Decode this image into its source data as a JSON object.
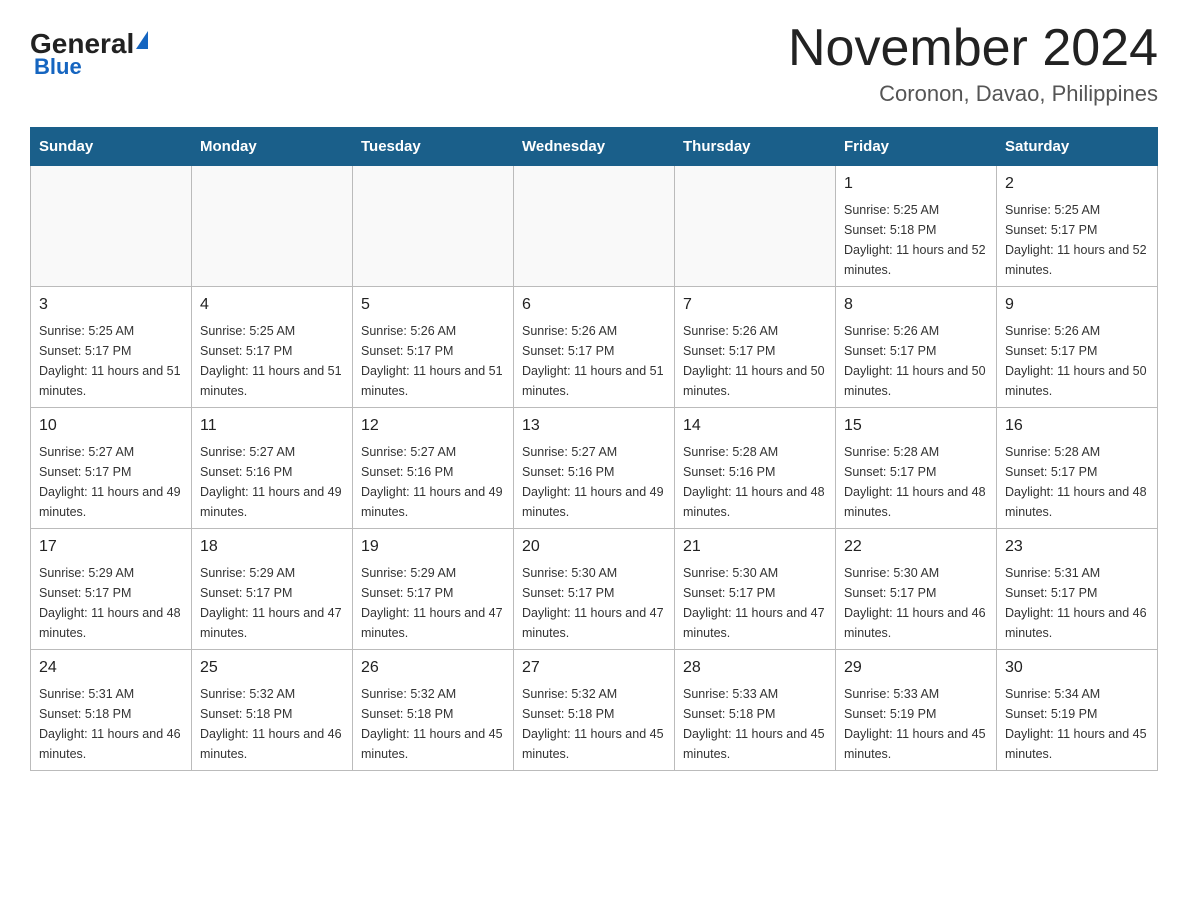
{
  "header": {
    "logo_general": "General",
    "logo_blue": "Blue",
    "month_title": "November 2024",
    "location": "Coronon, Davao, Philippines"
  },
  "weekdays": [
    "Sunday",
    "Monday",
    "Tuesday",
    "Wednesday",
    "Thursday",
    "Friday",
    "Saturday"
  ],
  "weeks": [
    [
      {
        "day": "",
        "sunrise": "",
        "sunset": "",
        "daylight": ""
      },
      {
        "day": "",
        "sunrise": "",
        "sunset": "",
        "daylight": ""
      },
      {
        "day": "",
        "sunrise": "",
        "sunset": "",
        "daylight": ""
      },
      {
        "day": "",
        "sunrise": "",
        "sunset": "",
        "daylight": ""
      },
      {
        "day": "",
        "sunrise": "",
        "sunset": "",
        "daylight": ""
      },
      {
        "day": "1",
        "sunrise": "Sunrise: 5:25 AM",
        "sunset": "Sunset: 5:18 PM",
        "daylight": "Daylight: 11 hours and 52 minutes."
      },
      {
        "day": "2",
        "sunrise": "Sunrise: 5:25 AM",
        "sunset": "Sunset: 5:17 PM",
        "daylight": "Daylight: 11 hours and 52 minutes."
      }
    ],
    [
      {
        "day": "3",
        "sunrise": "Sunrise: 5:25 AM",
        "sunset": "Sunset: 5:17 PM",
        "daylight": "Daylight: 11 hours and 51 minutes."
      },
      {
        "day": "4",
        "sunrise": "Sunrise: 5:25 AM",
        "sunset": "Sunset: 5:17 PM",
        "daylight": "Daylight: 11 hours and 51 minutes."
      },
      {
        "day": "5",
        "sunrise": "Sunrise: 5:26 AM",
        "sunset": "Sunset: 5:17 PM",
        "daylight": "Daylight: 11 hours and 51 minutes."
      },
      {
        "day": "6",
        "sunrise": "Sunrise: 5:26 AM",
        "sunset": "Sunset: 5:17 PM",
        "daylight": "Daylight: 11 hours and 51 minutes."
      },
      {
        "day": "7",
        "sunrise": "Sunrise: 5:26 AM",
        "sunset": "Sunset: 5:17 PM",
        "daylight": "Daylight: 11 hours and 50 minutes."
      },
      {
        "day": "8",
        "sunrise": "Sunrise: 5:26 AM",
        "sunset": "Sunset: 5:17 PM",
        "daylight": "Daylight: 11 hours and 50 minutes."
      },
      {
        "day": "9",
        "sunrise": "Sunrise: 5:26 AM",
        "sunset": "Sunset: 5:17 PM",
        "daylight": "Daylight: 11 hours and 50 minutes."
      }
    ],
    [
      {
        "day": "10",
        "sunrise": "Sunrise: 5:27 AM",
        "sunset": "Sunset: 5:17 PM",
        "daylight": "Daylight: 11 hours and 49 minutes."
      },
      {
        "day": "11",
        "sunrise": "Sunrise: 5:27 AM",
        "sunset": "Sunset: 5:16 PM",
        "daylight": "Daylight: 11 hours and 49 minutes."
      },
      {
        "day": "12",
        "sunrise": "Sunrise: 5:27 AM",
        "sunset": "Sunset: 5:16 PM",
        "daylight": "Daylight: 11 hours and 49 minutes."
      },
      {
        "day": "13",
        "sunrise": "Sunrise: 5:27 AM",
        "sunset": "Sunset: 5:16 PM",
        "daylight": "Daylight: 11 hours and 49 minutes."
      },
      {
        "day": "14",
        "sunrise": "Sunrise: 5:28 AM",
        "sunset": "Sunset: 5:16 PM",
        "daylight": "Daylight: 11 hours and 48 minutes."
      },
      {
        "day": "15",
        "sunrise": "Sunrise: 5:28 AM",
        "sunset": "Sunset: 5:17 PM",
        "daylight": "Daylight: 11 hours and 48 minutes."
      },
      {
        "day": "16",
        "sunrise": "Sunrise: 5:28 AM",
        "sunset": "Sunset: 5:17 PM",
        "daylight": "Daylight: 11 hours and 48 minutes."
      }
    ],
    [
      {
        "day": "17",
        "sunrise": "Sunrise: 5:29 AM",
        "sunset": "Sunset: 5:17 PM",
        "daylight": "Daylight: 11 hours and 48 minutes."
      },
      {
        "day": "18",
        "sunrise": "Sunrise: 5:29 AM",
        "sunset": "Sunset: 5:17 PM",
        "daylight": "Daylight: 11 hours and 47 minutes."
      },
      {
        "day": "19",
        "sunrise": "Sunrise: 5:29 AM",
        "sunset": "Sunset: 5:17 PM",
        "daylight": "Daylight: 11 hours and 47 minutes."
      },
      {
        "day": "20",
        "sunrise": "Sunrise: 5:30 AM",
        "sunset": "Sunset: 5:17 PM",
        "daylight": "Daylight: 11 hours and 47 minutes."
      },
      {
        "day": "21",
        "sunrise": "Sunrise: 5:30 AM",
        "sunset": "Sunset: 5:17 PM",
        "daylight": "Daylight: 11 hours and 47 minutes."
      },
      {
        "day": "22",
        "sunrise": "Sunrise: 5:30 AM",
        "sunset": "Sunset: 5:17 PM",
        "daylight": "Daylight: 11 hours and 46 minutes."
      },
      {
        "day": "23",
        "sunrise": "Sunrise: 5:31 AM",
        "sunset": "Sunset: 5:17 PM",
        "daylight": "Daylight: 11 hours and 46 minutes."
      }
    ],
    [
      {
        "day": "24",
        "sunrise": "Sunrise: 5:31 AM",
        "sunset": "Sunset: 5:18 PM",
        "daylight": "Daylight: 11 hours and 46 minutes."
      },
      {
        "day": "25",
        "sunrise": "Sunrise: 5:32 AM",
        "sunset": "Sunset: 5:18 PM",
        "daylight": "Daylight: 11 hours and 46 minutes."
      },
      {
        "day": "26",
        "sunrise": "Sunrise: 5:32 AM",
        "sunset": "Sunset: 5:18 PM",
        "daylight": "Daylight: 11 hours and 45 minutes."
      },
      {
        "day": "27",
        "sunrise": "Sunrise: 5:32 AM",
        "sunset": "Sunset: 5:18 PM",
        "daylight": "Daylight: 11 hours and 45 minutes."
      },
      {
        "day": "28",
        "sunrise": "Sunrise: 5:33 AM",
        "sunset": "Sunset: 5:18 PM",
        "daylight": "Daylight: 11 hours and 45 minutes."
      },
      {
        "day": "29",
        "sunrise": "Sunrise: 5:33 AM",
        "sunset": "Sunset: 5:19 PM",
        "daylight": "Daylight: 11 hours and 45 minutes."
      },
      {
        "day": "30",
        "sunrise": "Sunrise: 5:34 AM",
        "sunset": "Sunset: 5:19 PM",
        "daylight": "Daylight: 11 hours and 45 minutes."
      }
    ]
  ]
}
